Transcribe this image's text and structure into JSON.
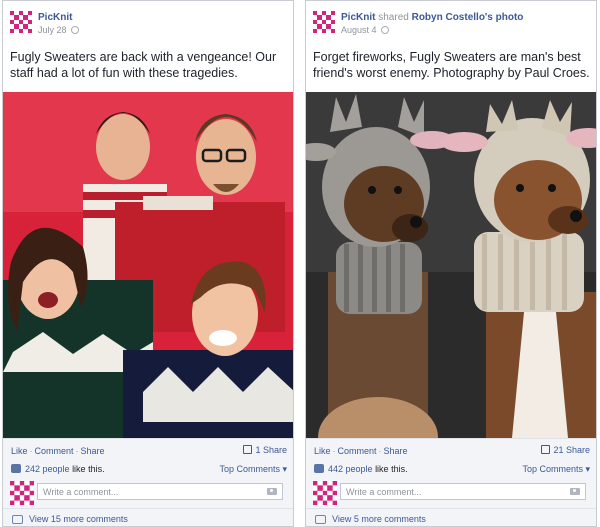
{
  "posts": [
    {
      "page_name": "PicKnit",
      "shared_text": "",
      "shared_owner": "",
      "date": "July 28",
      "message": "Fugly Sweaters are back with a vengeance! Our staff had a lot of fun with these tragedies.",
      "actions": {
        "like": "Like",
        "comment": "Comment",
        "share": "Share"
      },
      "share_count": "1 Share",
      "likes_count": "242 people",
      "likes_suffix": "like this.",
      "top_comments": "Top Comments ▾",
      "comment_placeholder": "Write a comment...",
      "more_comments": "View 15 more comments"
    },
    {
      "page_name": "PicKnit",
      "shared_text": "shared",
      "shared_owner": "Robyn Costello's photo",
      "date": "August 4",
      "message": "Forget fireworks, Fugly Sweaters are man's best friend's worst enemy. Photography by Paul Croes.",
      "actions": {
        "like": "Like",
        "comment": "Comment",
        "share": "Share"
      },
      "share_count": "21 Share",
      "likes_count": "442 people",
      "likes_suffix": "like this.",
      "top_comments": "Top Comments ▾",
      "comment_placeholder": "Write a comment...",
      "more_comments": "View 5 more comments"
    }
  ],
  "colors": {
    "brand": "#d4237a",
    "link": "#3b5998",
    "muted": "#90949c",
    "footer_bg": "#f3f4f7"
  },
  "icons": [
    "picknit-logo-icon",
    "globe-icon",
    "share-icon",
    "thumbs-up-icon",
    "camera-icon",
    "comment-bubble-icon"
  ]
}
